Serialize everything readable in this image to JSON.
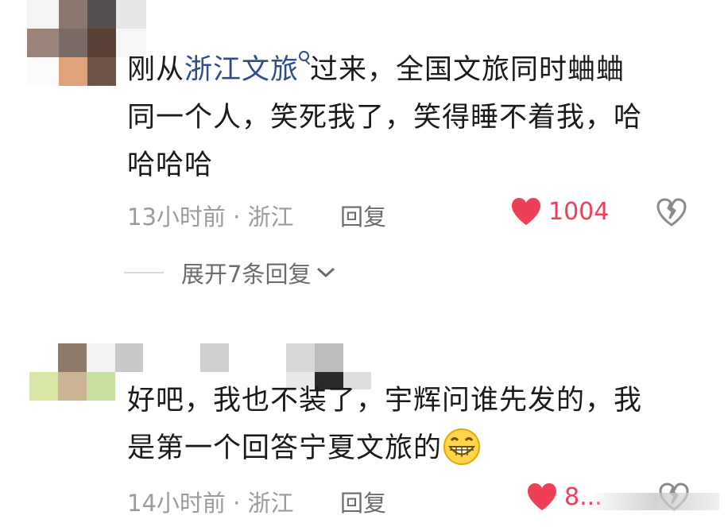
{
  "comments": [
    {
      "text_before": "刚从",
      "link_text": "浙江文旅",
      "line1_after": "过来，全国文旅同时蛐蛐",
      "line2": "同一个人，笑死我了，笑得睡不着我，哈",
      "line3": "哈哈哈",
      "meta": "13小时前 · 浙江",
      "reply_label": "回复",
      "like_count": "1004"
    },
    {
      "line1": "好吧，我也不装了，宇辉问谁先发的，我",
      "line2": "是第一个回答宁夏文旅的",
      "emoji": "grinning-face",
      "meta": "14小时前 · 浙江",
      "reply_label": "回复",
      "like_count": "8..."
    }
  ],
  "expand_replies": "展开7条回复",
  "colors": {
    "like": "#ef3f57",
    "link": "#2f4d86",
    "meta": "#9b9b9b"
  }
}
